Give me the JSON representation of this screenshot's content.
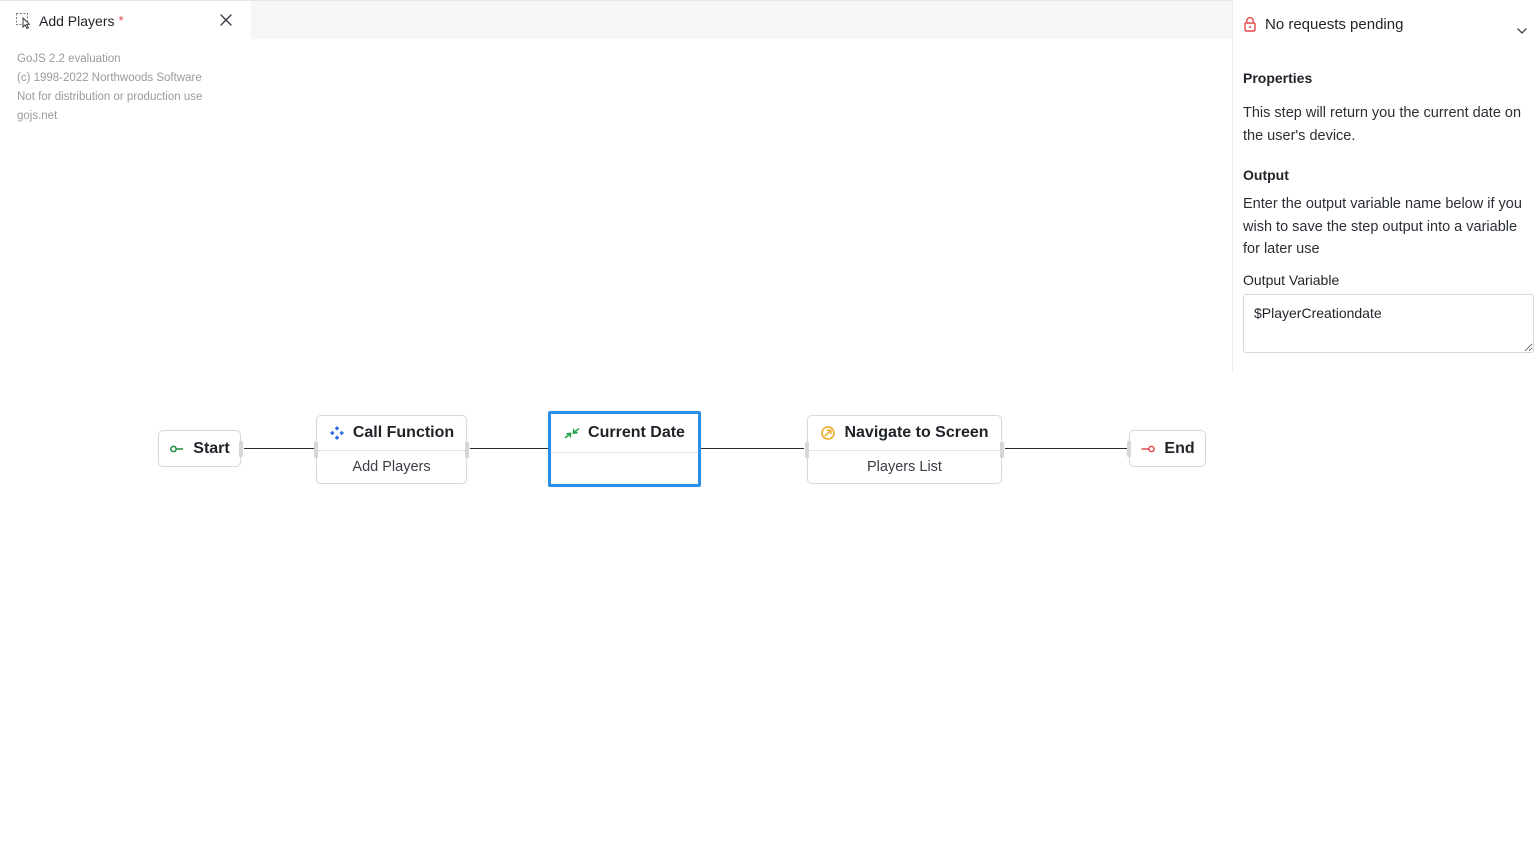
{
  "tab": {
    "label": "Add Players",
    "dirty_marker": "*"
  },
  "watermark": {
    "line1": "GoJS 2.2 evaluation",
    "line2": "(c) 1998-2022 Northwoods Software",
    "line3": "Not for distribution or production use",
    "line4": "gojs.net"
  },
  "requests": {
    "label": "No requests pending"
  },
  "properties": {
    "heading": "Properties",
    "description": "This step will return you the current date on the user's device.",
    "output_heading": "Output",
    "output_description": "Enter the output variable name below if you wish to save the step output into a variable for later use",
    "output_variable_label": "Output Variable",
    "output_variable_value": "$PlayerCreationdate"
  },
  "flow": {
    "start": {
      "title": "Start"
    },
    "call_function": {
      "title": "Call Function",
      "subtitle": "Add Players"
    },
    "current_date": {
      "title": "Current Date",
      "subtitle": ""
    },
    "navigate": {
      "title": "Navigate to Screen",
      "subtitle": "Players List"
    },
    "end": {
      "title": "End"
    }
  },
  "colors": {
    "start_icon": "#1a8a3a",
    "call_icon": "#2f6fe0",
    "date_icon": "#22a447",
    "nav_icon": "#e9a820",
    "end_icon": "#e5484d",
    "selection": "#2b8fe8",
    "dirty": "#e5484d"
  },
  "icons": {
    "tab": "select-cursor-icon",
    "close": "close-icon",
    "lock": "lock-icon",
    "chevron": "chevron-down-icon",
    "start": "start-icon",
    "call": "function-icon",
    "date": "date-icon",
    "nav": "navigate-icon",
    "end": "end-icon"
  }
}
